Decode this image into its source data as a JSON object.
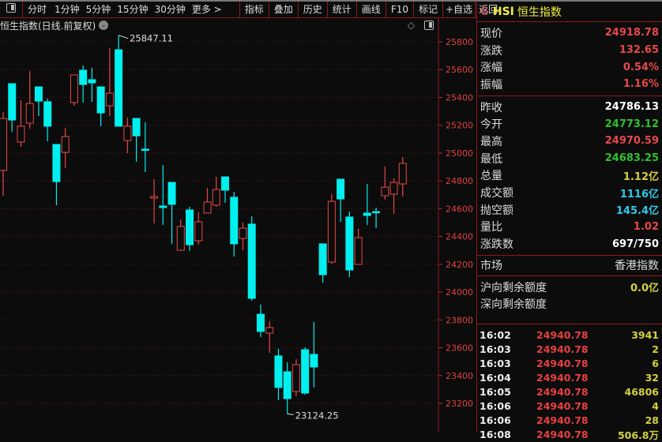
{
  "toolbar": {
    "items": [
      "分时",
      "1分钟",
      "5分钟",
      "15分钟",
      "30分钟",
      "更多 >"
    ],
    "actions": [
      "指标",
      "叠加",
      "历史",
      "统计",
      "画线",
      "F10",
      "标记",
      "+自选",
      "返回"
    ]
  },
  "chart": {
    "title": "恒生指数(日线.前复权)",
    "high_label": "25847.11",
    "low_label": "23124.25"
  },
  "chart_data": {
    "type": "candlestick",
    "ylim": [
      23100,
      25900
    ],
    "y_ticks": [
      25800,
      25600,
      25400,
      25200,
      25000,
      24800,
      24600,
      24400,
      24200,
      24000,
      23800,
      23600,
      23400,
      23200
    ],
    "up_color": "#e84848",
    "down_color": "#00f0f0",
    "candles": [
      [
        24875,
        25295,
        24693,
        25249
      ],
      [
        25499,
        25499,
        25153,
        25238
      ],
      [
        25079,
        25380,
        25045,
        25193
      ],
      [
        25215,
        25590,
        25176,
        25357
      ],
      [
        25476,
        25476,
        25266,
        25374
      ],
      [
        25369,
        25391,
        25085,
        25193
      ],
      [
        25062,
        25062,
        24625,
        24795
      ],
      [
        25005,
        25181,
        24892,
        25119
      ],
      [
        25363,
        25562,
        25340,
        25562
      ],
      [
        25596,
        25630,
        25363,
        25493
      ],
      [
        25528,
        25613,
        25369,
        25505
      ],
      [
        25476,
        25476,
        25193,
        25289
      ],
      [
        25340,
        25755,
        25266,
        25431
      ],
      [
        25743,
        25847.11,
        25193,
        25193
      ],
      [
        25090,
        25255,
        24999,
        25193
      ],
      [
        25249,
        25249,
        24937,
        25124
      ],
      [
        25028,
        25221,
        24863,
        25022
      ],
      [
        24676,
        24812,
        24494,
        24687
      ],
      [
        24619,
        24914,
        24483,
        24608
      ],
      [
        24789,
        24789,
        24347,
        24631
      ],
      [
        24301,
        24523,
        24296,
        24472
      ],
      [
        24591,
        24614,
        24296,
        24341
      ],
      [
        24369,
        24574,
        24341,
        24506
      ],
      [
        24568,
        24750,
        24568,
        24648
      ],
      [
        24625,
        24829,
        24614,
        24738
      ],
      [
        24829,
        24829,
        24642,
        24733
      ],
      [
        24682,
        24721,
        24256,
        24347
      ],
      [
        24386,
        24500,
        24301,
        24460
      ],
      [
        24489,
        24545,
        23938,
        23955
      ],
      [
        23841,
        23910,
        23677,
        23717
      ],
      [
        23705,
        23790,
        23563,
        23745
      ],
      [
        23541,
        23592,
        23223,
        23314
      ],
      [
        23427,
        23495,
        23124.25,
        23234
      ],
      [
        23285,
        23518,
        23251,
        23478
      ],
      [
        23586,
        23603,
        23262,
        23274
      ],
      [
        23552,
        23785,
        23314,
        23461
      ],
      [
        24347,
        24347,
        24068,
        24125
      ],
      [
        24216,
        24704,
        24205,
        24653
      ],
      [
        24812,
        24812,
        24506,
        24670
      ],
      [
        24540,
        24579,
        24108,
        24159
      ],
      [
        24199,
        24455,
        24199,
        24392
      ],
      [
        24568,
        24778,
        24483,
        24551
      ],
      [
        24579,
        24608,
        24460,
        24574
      ],
      [
        24693,
        24903,
        24665,
        24755
      ],
      [
        24704,
        24818,
        24563,
        24789
      ],
      [
        24778,
        24971,
        24687,
        24926
      ]
    ]
  },
  "quote": {
    "header_g": "G",
    "header_code": "HSI",
    "header_name": "恒生指数",
    "rows1": [
      {
        "label": "现价",
        "value": "24918.78",
        "color": "#e84848"
      },
      {
        "label": "涨跌",
        "value": "132.65",
        "color": "#e84848"
      },
      {
        "label": "涨幅",
        "value": "0.54%",
        "color": "#e84848"
      },
      {
        "label": "振幅",
        "value": "1.16%",
        "color": "#e84848"
      }
    ],
    "rows2": [
      {
        "label": "昨收",
        "value": "24786.13",
        "color": "#ffffff"
      },
      {
        "label": "今开",
        "value": "24773.12",
        "color": "#30c030"
      },
      {
        "label": "最高",
        "value": "24970.59",
        "color": "#e84848"
      },
      {
        "label": "最低",
        "value": "24683.25",
        "color": "#30c030"
      },
      {
        "label": "总量",
        "value": "1.12亿",
        "color": "#d4d040"
      },
      {
        "label": "成交额",
        "value": "1116亿",
        "color": "#30c8e8"
      },
      {
        "label": "抛空额",
        "value": "145.4亿",
        "color": "#30c8e8"
      },
      {
        "label": "量比",
        "value": "1.02",
        "color": "#e84848"
      },
      {
        "label": "涨跌数",
        "value": "697/750",
        "color": "#ffffff"
      }
    ],
    "market_label": "市场",
    "market_value": "香港指数",
    "north_sh_label": "沪向剩余额度",
    "north_sh_value": "0.0亿",
    "north_sz_label": "深向剩余额度"
  },
  "ticks": [
    [
      "16:02",
      "24940.78",
      "3941"
    ],
    [
      "16:03",
      "24940.78",
      "2"
    ],
    [
      "16:03",
      "24940.78",
      "6"
    ],
    [
      "16:04",
      "24940.78",
      "32"
    ],
    [
      "16:05",
      "24940.78",
      "46806"
    ],
    [
      "16:06",
      "24940.78",
      "4"
    ],
    [
      "16:06",
      "24940.78",
      "28"
    ],
    [
      "16:08",
      "24940.78",
      "506.8万"
    ]
  ]
}
